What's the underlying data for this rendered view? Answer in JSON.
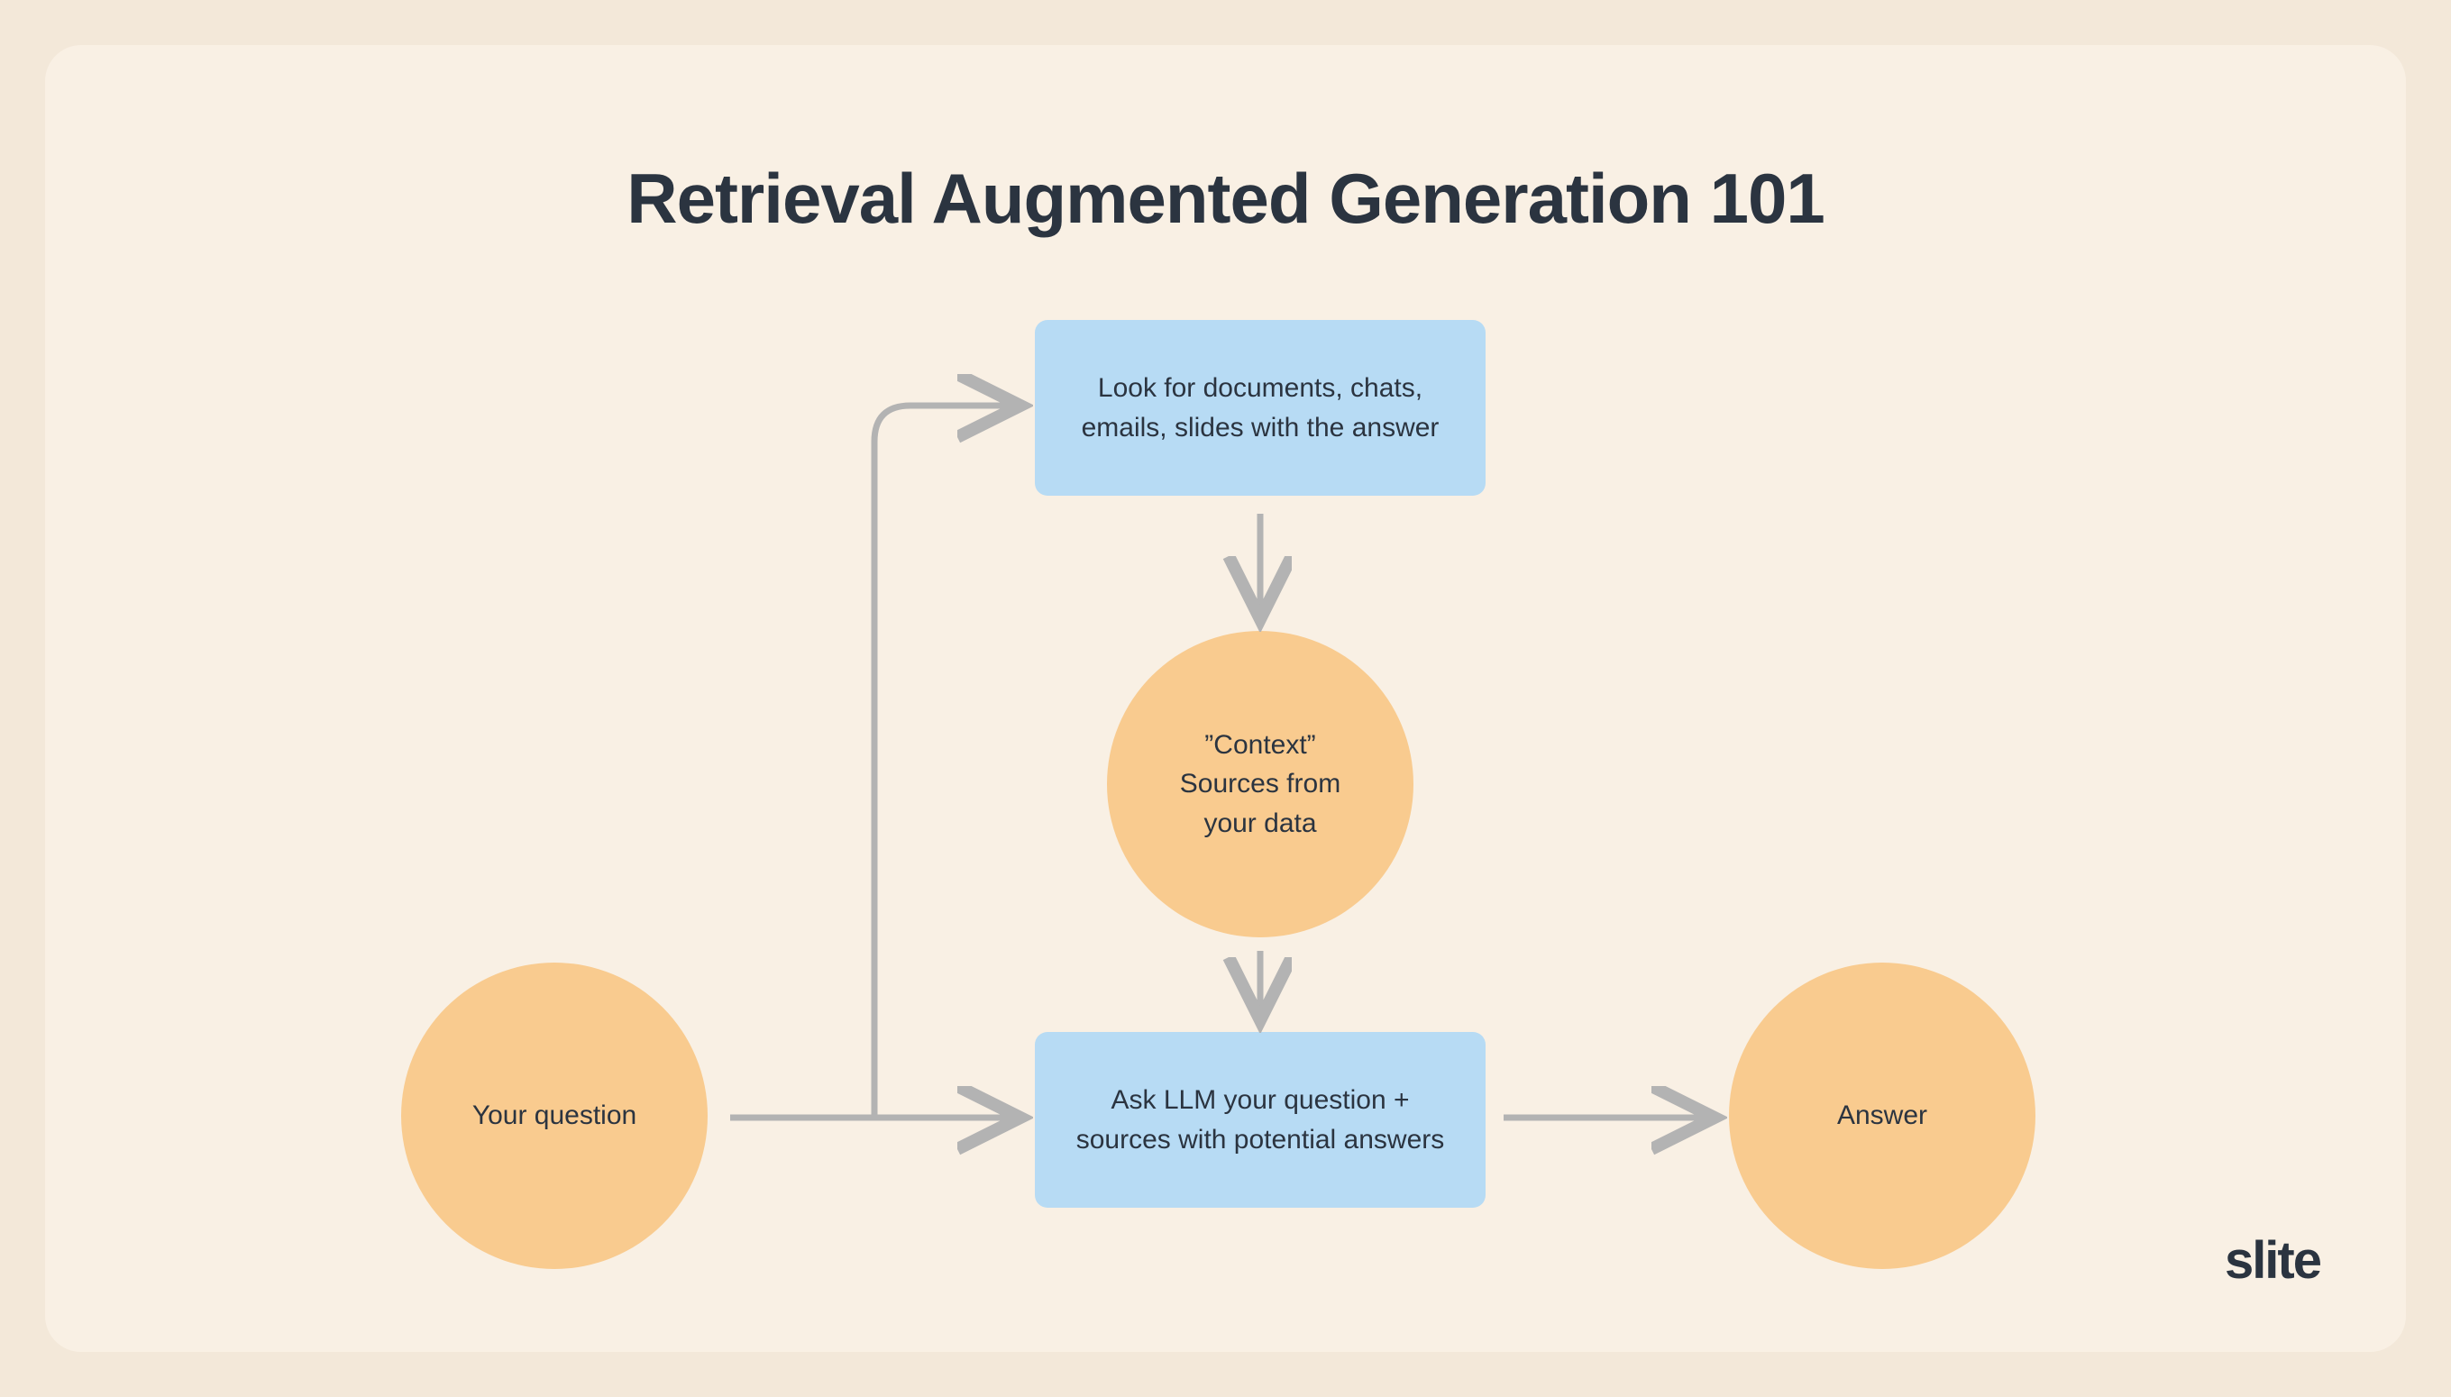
{
  "title": "Retrieval Augmented Generation 101",
  "nodes": {
    "question": "Your question",
    "lookup": "Look for documents, chats, emails, slides with the answer",
    "context": "”Context”\nSources from\nyour data",
    "ask": "Ask LLM your question + sources with potential answers",
    "answer": "Answer"
  },
  "brand": "slite",
  "colors": {
    "background_outer": "#f3e8d9",
    "background_inner": "#f9f0e4",
    "circle": "#f9cb8f",
    "box": "#b7dbf4",
    "text": "#2b3440",
    "arrow": "#b3b3b3"
  }
}
